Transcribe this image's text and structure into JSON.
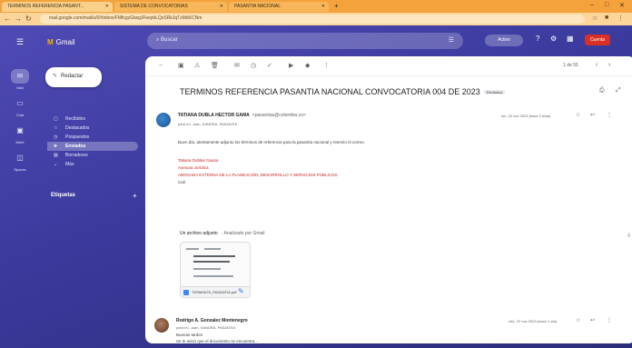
{
  "browser": {
    "tabs": [
      {
        "label": "TERMINOS REFERENCIA PASANT..."
      },
      {
        "label": "SISTEMA DE CONVOCATORIAS"
      },
      {
        "label": "PASANTIA NACIONAL"
      }
    ],
    "new_tab": "+",
    "url": "mail.google.com/mail/u/0/#inbox/FMfcgzGtwgJFwqrbLQxSRkJqTzMdXCNm",
    "window_controls": [
      "–",
      "□",
      "✕"
    ]
  },
  "gmail": {
    "app_name": "Gmail",
    "search_placeholder": "Buscar",
    "status": "Activo",
    "profile_badge": "Cuenta",
    "compose_label": "Redactar",
    "rail": [
      {
        "icon": "mail-icon",
        "label": "Mail"
      },
      {
        "icon": "chat-icon",
        "label": "Chat"
      },
      {
        "icon": "meet-icon",
        "label": "Meet"
      },
      {
        "icon": "spaces-icon",
        "label": "Spaces"
      }
    ],
    "nav": [
      {
        "label": "Recibidos",
        "icon": "inbox-icon",
        "active": false
      },
      {
        "label": "Destacados",
        "icon": "star-icon",
        "active": false
      },
      {
        "label": "Pospuestos",
        "icon": "clock-icon",
        "active": false
      },
      {
        "label": "Enviados",
        "icon": "send-icon",
        "active": true
      },
      {
        "label": "Borradores",
        "icon": "draft-icon",
        "active": false
      },
      {
        "label": "Más",
        "icon": "chevron-down-icon",
        "active": false
      }
    ],
    "labels_heading": "Etiquetas",
    "labels_add": "+"
  },
  "thread": {
    "pager": "1 de 55",
    "subject": "TERMINOS REFERENCIA PASANTIA NACIONAL CONVOCATORIA 004 DE 2023",
    "subject_badge": "Recibidos",
    "messages": [
      {
        "sender": "TATIANA DUBLA HECTOR GAMA",
        "address": "<pasantias@colombia.co>",
        "to": "para mí, Juan, SANDRA, PASANTIA",
        "date": "lun, 20 nov 2023 (hace 2 días)",
        "body": [
          "Buen día, atentamente adjunto los términos de referencia para la pasantía nacional y reenvío el correo.",
          "",
          "Tatiana Dublas Gaona",
          "Asesora Jurídica",
          "ABOGADA EXTERNA DE LA PLANEACIÓN, DESARROLLO Y SERVICIOS PÚBLICOS",
          "Cali"
        ]
      },
      {
        "sender": "Rodrigo A. Gonzalez Montenegro",
        "address": "",
        "to": "para mí, Juan, SANDRA, PASANTIA",
        "date": "mié, 22 nov 2023 (hace 1 día)",
        "body": [
          "Buenas tardes",
          "Se le avisó que el documento se encuentra..."
        ]
      }
    ],
    "attachments": {
      "heading": "Un archivo adjunto",
      "scan_note": "· Analizado por Gmail",
      "file_name": "TERMINOS_PASANTIA.pdf"
    }
  }
}
